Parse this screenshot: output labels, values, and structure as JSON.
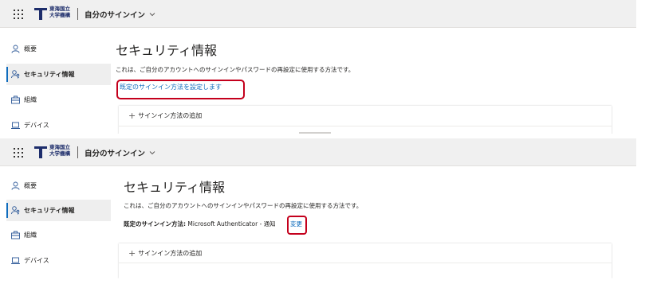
{
  "app": {
    "org_line1": "東海国立",
    "org_line2": "大学機構",
    "title": "自分のサインイン"
  },
  "nav": {
    "items": [
      {
        "label": "概要",
        "icon": "person-icon"
      },
      {
        "label": "セキュリティ情報",
        "icon": "person-key-icon"
      },
      {
        "label": "組織",
        "icon": "briefcase-icon"
      },
      {
        "label": "デバイス",
        "icon": "laptop-icon"
      }
    ]
  },
  "page": {
    "title": "セキュリティ情報",
    "description": "これは、ご自分のアカウントへのサインインやパスワードの再設定に使用する方法です。"
  },
  "panel1": {
    "set_default_link": "既定のサインイン方法を設定します",
    "add_method": "サインイン方法の追加"
  },
  "panel2": {
    "default_label": "既定のサインイン方法:",
    "default_value": "Microsoft Authenticator - 通知",
    "change_link": "変更",
    "add_method": "サインイン方法の追加"
  },
  "colors": {
    "accent": "#0f6cbd",
    "highlight": "#c4001c",
    "topbar": "#f0f0f0"
  }
}
